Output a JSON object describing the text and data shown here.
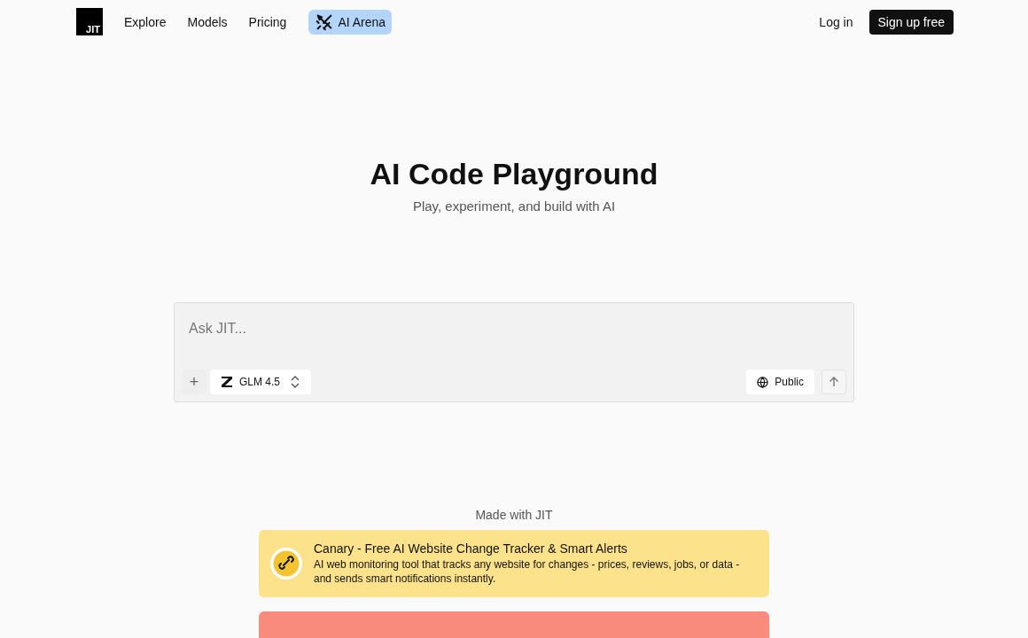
{
  "nav": {
    "logo": "JIT",
    "links": [
      {
        "label": "Explore"
      },
      {
        "label": "Models"
      },
      {
        "label": "Pricing"
      }
    ],
    "arena": {
      "label": "AI Arena"
    },
    "login": "Log in",
    "signup": "Sign up free"
  },
  "hero": {
    "title": "AI Code Playground",
    "subtitle": "Play, experiment, and build with AI"
  },
  "prompt": {
    "placeholder": "Ask JIT...",
    "add": "+",
    "model": "GLM 4.5",
    "visibility": "Public"
  },
  "showcase": {
    "heading": "Made with JIT",
    "cards": [
      {
        "title": "Canary - Free AI Website Change Tracker & Smart Alerts",
        "description": "AI web monitoring tool that tracks any website for changes - prices, reviews, jobs, or data - and sends smart notifications instantly.",
        "color": "#fce28a"
      },
      {
        "color": "#f98b7d"
      }
    ]
  }
}
